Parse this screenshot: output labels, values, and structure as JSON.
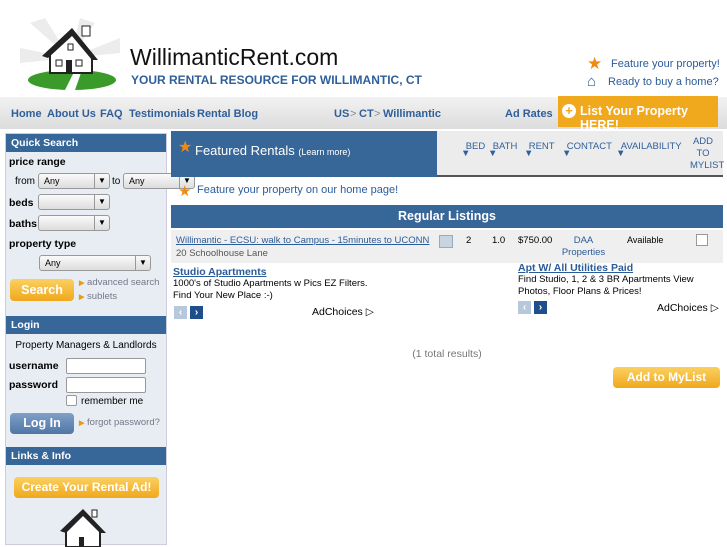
{
  "header": {
    "site_title": "WillimanticRent.com",
    "tagline": "YOUR RENTAL RESOURCE FOR WILLIMANTIC, CT",
    "feature_link": "Feature your property!",
    "buy_link": "Ready to buy a home?"
  },
  "nav": {
    "items": [
      "Home",
      "About Us",
      "FAQ",
      "Testimonials",
      "Rental Blog"
    ],
    "breadcrumb": [
      "US",
      ">",
      "CT",
      ">",
      "Willimantic"
    ],
    "ad_rates": "Ad Rates",
    "list_button": "List Your Property HERE!"
  },
  "sidebar": {
    "quick_search": {
      "title": "Quick Search",
      "price_range": "price range",
      "from": "from",
      "to": "to",
      "from_value": "Any",
      "to_value": "Any",
      "beds": "beds",
      "baths": "baths",
      "property_type": "property type",
      "property_type_value": "Any",
      "search": "Search",
      "advanced": "advanced search",
      "sublets": "sublets"
    },
    "login": {
      "title": "Login",
      "subtitle": "Property Managers & Landlords",
      "username": "username",
      "password": "password",
      "remember": "remember me",
      "button": "Log In",
      "forgot": "forgot password?"
    },
    "links": {
      "title": "Links & Info",
      "create": "Create Your Rental Ad!"
    }
  },
  "main": {
    "featured_title": "Featured Rentals",
    "learn_more": "(Learn more)",
    "columns": [
      "BED",
      "BATH",
      "RENT",
      "CONTACT",
      "AVAILABILITY",
      "ADD TO MYLIST"
    ],
    "feature_home": "Feature your property on our home page!",
    "regular_title": "Regular Listings",
    "listing": {
      "title": "Willimantic - ECSU: walk to Campus - 15minutes to UCONN",
      "address": "20 Schoolhouse Lane",
      "bed": "2",
      "bath": "1.0",
      "rent": "$750.00",
      "contact": "DAA Properties",
      "availability": "Available"
    },
    "ads": [
      {
        "title": "Studio Apartments",
        "line1": "1000's of Studio Apartments w Pics EZ Filters.",
        "line2": "Find Your New Place :-)",
        "choices": "AdChoices"
      },
      {
        "title": "Apt W/ All Utilities Paid",
        "line1": "Find Studio, 1, 2 & 3 BR Apartments View",
        "line2": "Photos, Floor Plans & Prices!",
        "choices": "AdChoices"
      }
    ],
    "results": "(1 total results)",
    "add_mylist": "Add to MyList"
  },
  "colors": {
    "brand_blue": "#376698",
    "accent_orange": "#f0a81c"
  }
}
